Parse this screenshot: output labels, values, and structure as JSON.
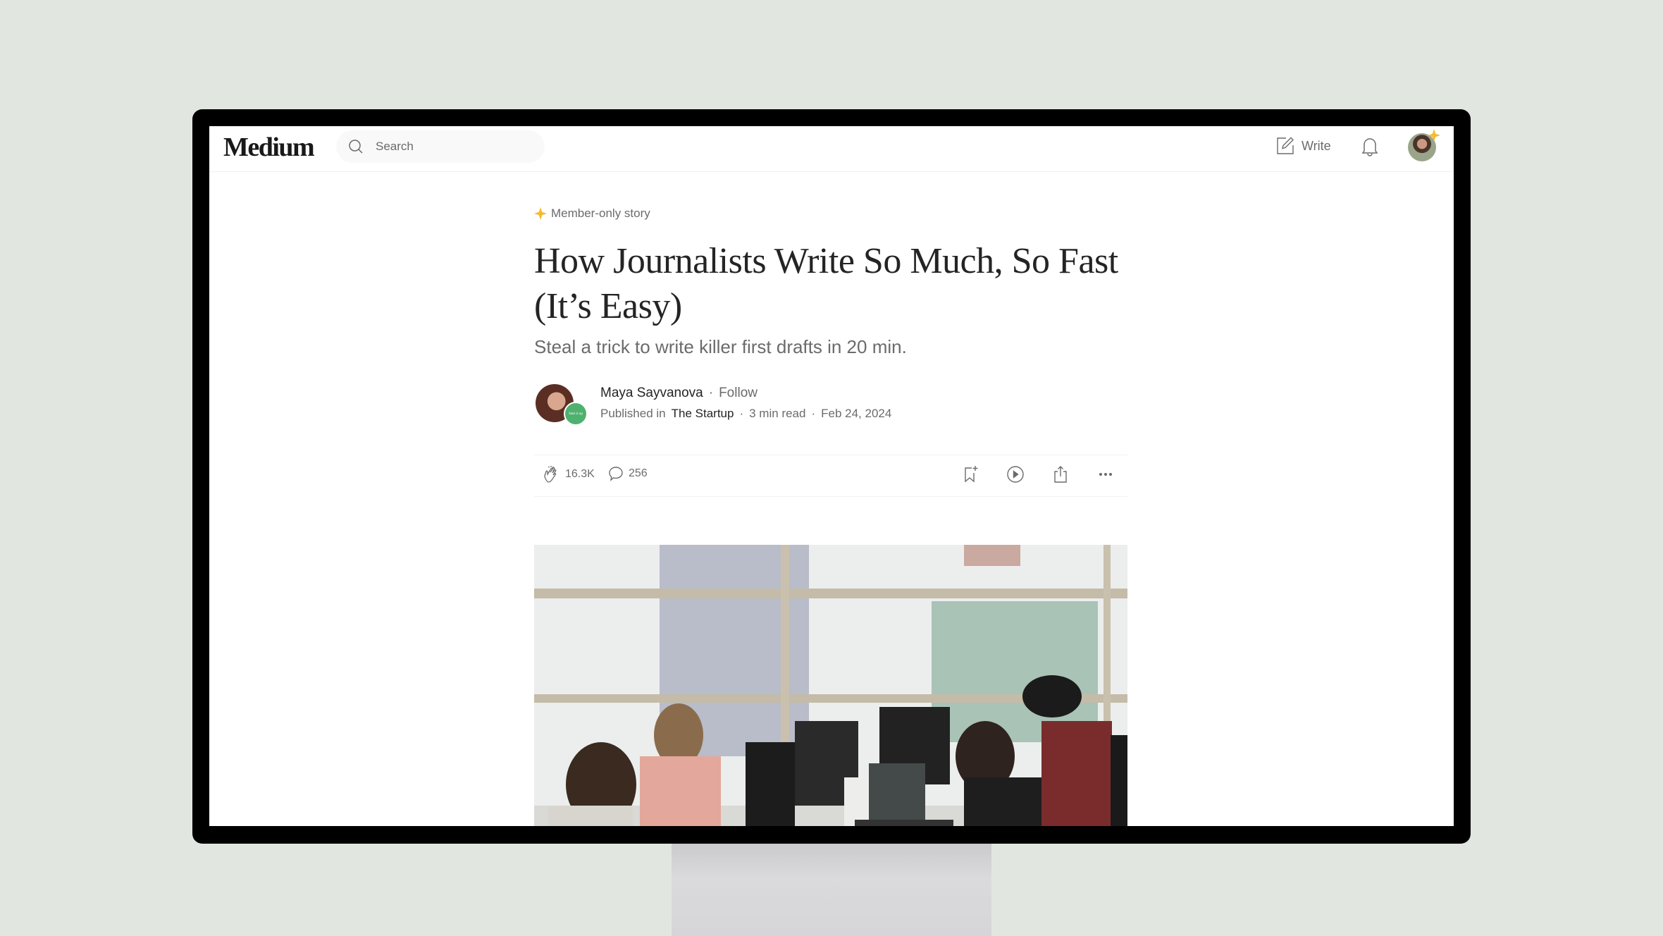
{
  "header": {
    "logo": "Medium",
    "search_placeholder": "Search",
    "write_label": "Write"
  },
  "article": {
    "member_label": "Member-only story",
    "title": "How Journalists Write So Much, So Fast (It’s Easy)",
    "subtitle": "Steal a trick to write killer first drafts in 20 min.",
    "author": "Maya Sayvanova",
    "follow_label": "Follow",
    "published_in_label": "Published in",
    "publication": "The Startup",
    "publication_badge": "Start it up",
    "read_time": "3 min read",
    "date": "Feb 24, 2024",
    "separator": "·",
    "claps": "16.3K",
    "responses": "256"
  },
  "icons": {
    "search": "search-icon",
    "write": "pencil-square-icon",
    "bell": "bell-icon",
    "member": "sparkle-icon",
    "clap": "clap-icon",
    "response": "speech-bubble-icon",
    "bookmark": "bookmark-add-icon",
    "listen": "play-circle-icon",
    "share": "share-icon",
    "more": "more-icon"
  },
  "colors": {
    "background": "#e1e6e0",
    "bezel": "#000000",
    "text_primary": "#242424",
    "text_secondary": "#6b6b6b",
    "member_star": "#f4bb33",
    "publication_badge": "#4fb16f"
  }
}
